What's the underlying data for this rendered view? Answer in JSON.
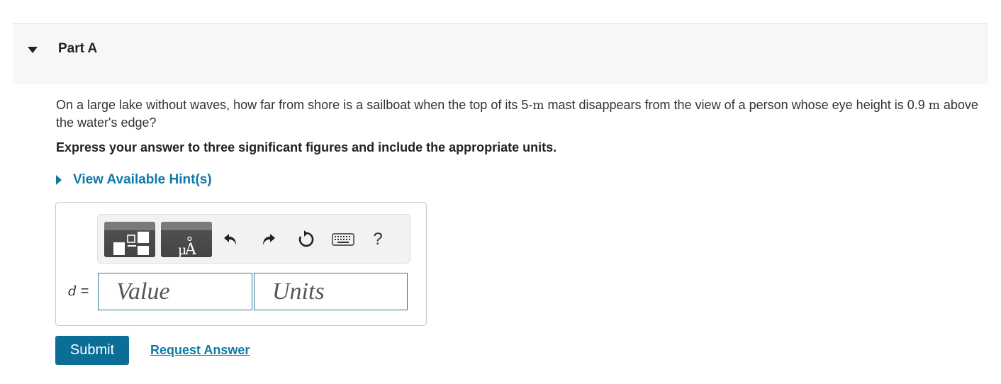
{
  "part": {
    "title": "Part A"
  },
  "question": {
    "text_1": "On a large lake without waves, how far from shore is a sailboat when the top of its 5-",
    "unit_1": "m",
    "text_2": " mast disappears from the view of a person whose eye height is 0.9 ",
    "unit_2": "m",
    "text_3": " above the water's edge?"
  },
  "instruction": "Express your answer to three significant figures and include the appropriate units.",
  "hint": {
    "label": "View Available Hint(s)"
  },
  "toolbar": {
    "buttons": [
      "templates-icon",
      "units-icon",
      "undo-icon",
      "redo-icon",
      "reset-icon",
      "keyboard-icon"
    ],
    "units_glyph": "μÅ",
    "help_label": "?"
  },
  "answer": {
    "variable": "d",
    "equals": "=",
    "value_placeholder": "Value",
    "units_placeholder": "Units"
  },
  "actions": {
    "submit_label": "Submit",
    "request_label": "Request Answer"
  },
  "colors": {
    "accent": "#0b6e96",
    "link": "#0f7aa5",
    "header_bg": "#f7f7f7"
  }
}
